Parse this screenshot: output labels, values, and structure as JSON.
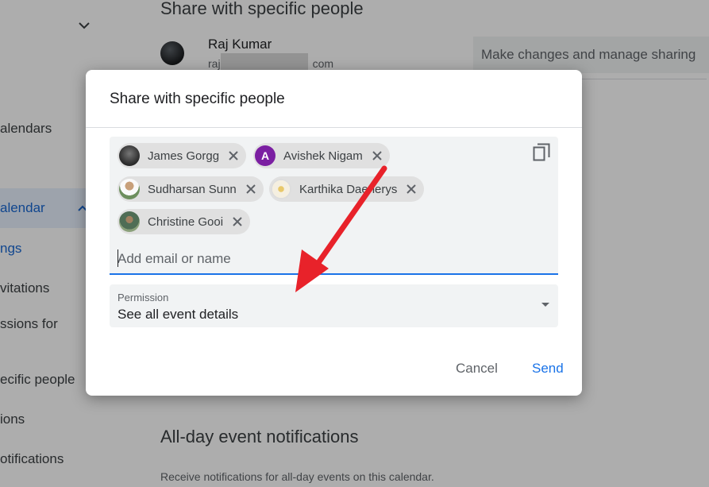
{
  "background": {
    "sidebar": {
      "items": [
        {
          "label": "alendars"
        },
        {
          "label": "alendar"
        },
        {
          "label": "ngs"
        },
        {
          "label": "vitations"
        },
        {
          "label": "ssions for"
        },
        {
          "label": "ecific people"
        },
        {
          "label": "ions"
        },
        {
          "label": "otifications"
        }
      ]
    },
    "main": {
      "section_title": "Share with specific people",
      "user_name": "Raj Kumar",
      "user_email_prefix": "raj",
      "user_email_suffix": "com",
      "manage_button": "Make changes and manage sharing",
      "allday_title": "All-day event notifications",
      "allday_subtitle": "Receive notifications for all-day events on this calendar."
    }
  },
  "dialog": {
    "title": "Share with specific people",
    "chips": [
      {
        "name": "James Gorgg",
        "initial": ""
      },
      {
        "name": "Avishek Nigam",
        "initial": "A"
      },
      {
        "name": "Sudharsan Sunn",
        "initial": ""
      },
      {
        "name": "Karthika Daenerys",
        "initial": ""
      },
      {
        "name": "Christine Gooi",
        "initial": ""
      }
    ],
    "input_placeholder": "Add email or name",
    "permission_label": "Permission",
    "permission_value": "See all event details",
    "cancel_label": "Cancel",
    "send_label": "Send"
  },
  "colors": {
    "accent": "#1a73e8",
    "avatar_avishek": "#7b1fa2",
    "annotation_arrow": "#e8222a"
  }
}
